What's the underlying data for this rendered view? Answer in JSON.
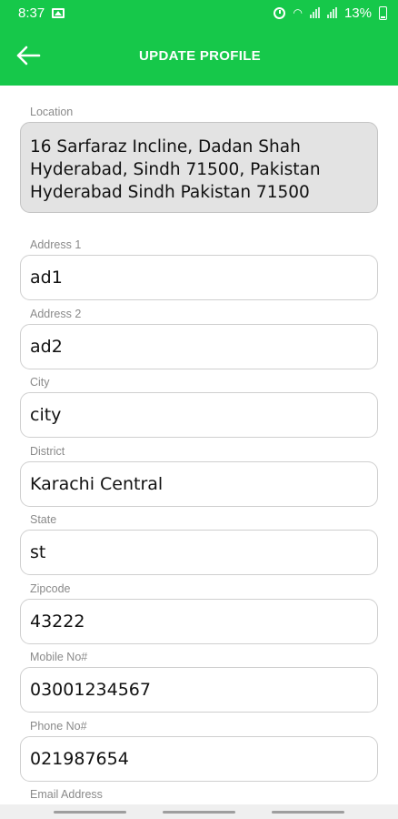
{
  "status_bar": {
    "time": "8:37",
    "battery": "13%"
  },
  "app_bar": {
    "title": "UPDATE PROFILE"
  },
  "form": {
    "location_label": "Location",
    "location_lines": [
      "16 Sarfaraz Incline, Dadan Shah",
      "Hyderabad, Sindh 71500, Pakistan",
      "Hyderabad Sindh Pakistan 71500"
    ],
    "fields": [
      {
        "label": "Address 1",
        "value": "ad1"
      },
      {
        "label": "Address 2",
        "value": "ad2"
      },
      {
        "label": "City",
        "value": "city"
      },
      {
        "label": "District",
        "value": "Karachi Central"
      },
      {
        "label": "State",
        "value": "st"
      },
      {
        "label": "Zipcode",
        "value": "43222"
      },
      {
        "label": "Mobile No#",
        "value": "03001234567"
      },
      {
        "label": "Phone No#",
        "value": "021987654"
      },
      {
        "label": "Email Address",
        "value": ""
      }
    ]
  },
  "colors": {
    "primary": "#16c84a",
    "location_bg": "#e3e3e3"
  }
}
